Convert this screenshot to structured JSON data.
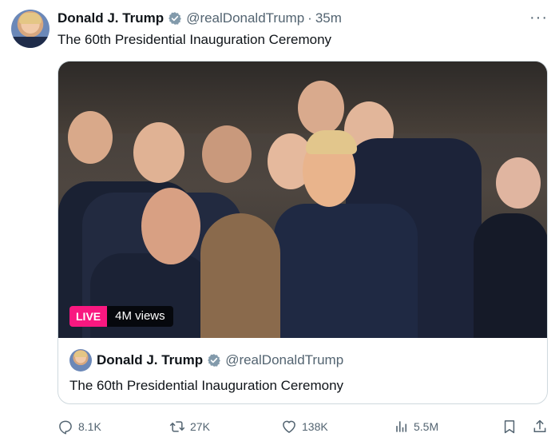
{
  "post": {
    "author_name": "Donald J. Trump",
    "handle": "@realDonaldTrump",
    "separator": "·",
    "time": "35m",
    "text": "The 60th Presidential Inauguration Ceremony",
    "more_icon": "more-horizontal-icon",
    "verified_color": "#1d9bf0"
  },
  "media": {
    "live_label": "LIVE",
    "views_label": "4M views",
    "live_color": "#f91880"
  },
  "card": {
    "author_name": "Donald J. Trump",
    "handle": "@realDonaldTrump",
    "text": "The 60th Presidential Inauguration Ceremony"
  },
  "actions": {
    "replies": "8.1K",
    "reposts": "27K",
    "likes": "138K",
    "views": "5.5M",
    "icons": [
      "reply-icon",
      "repost-icon",
      "like-icon",
      "views-icon",
      "bookmark-icon",
      "share-icon"
    ]
  }
}
